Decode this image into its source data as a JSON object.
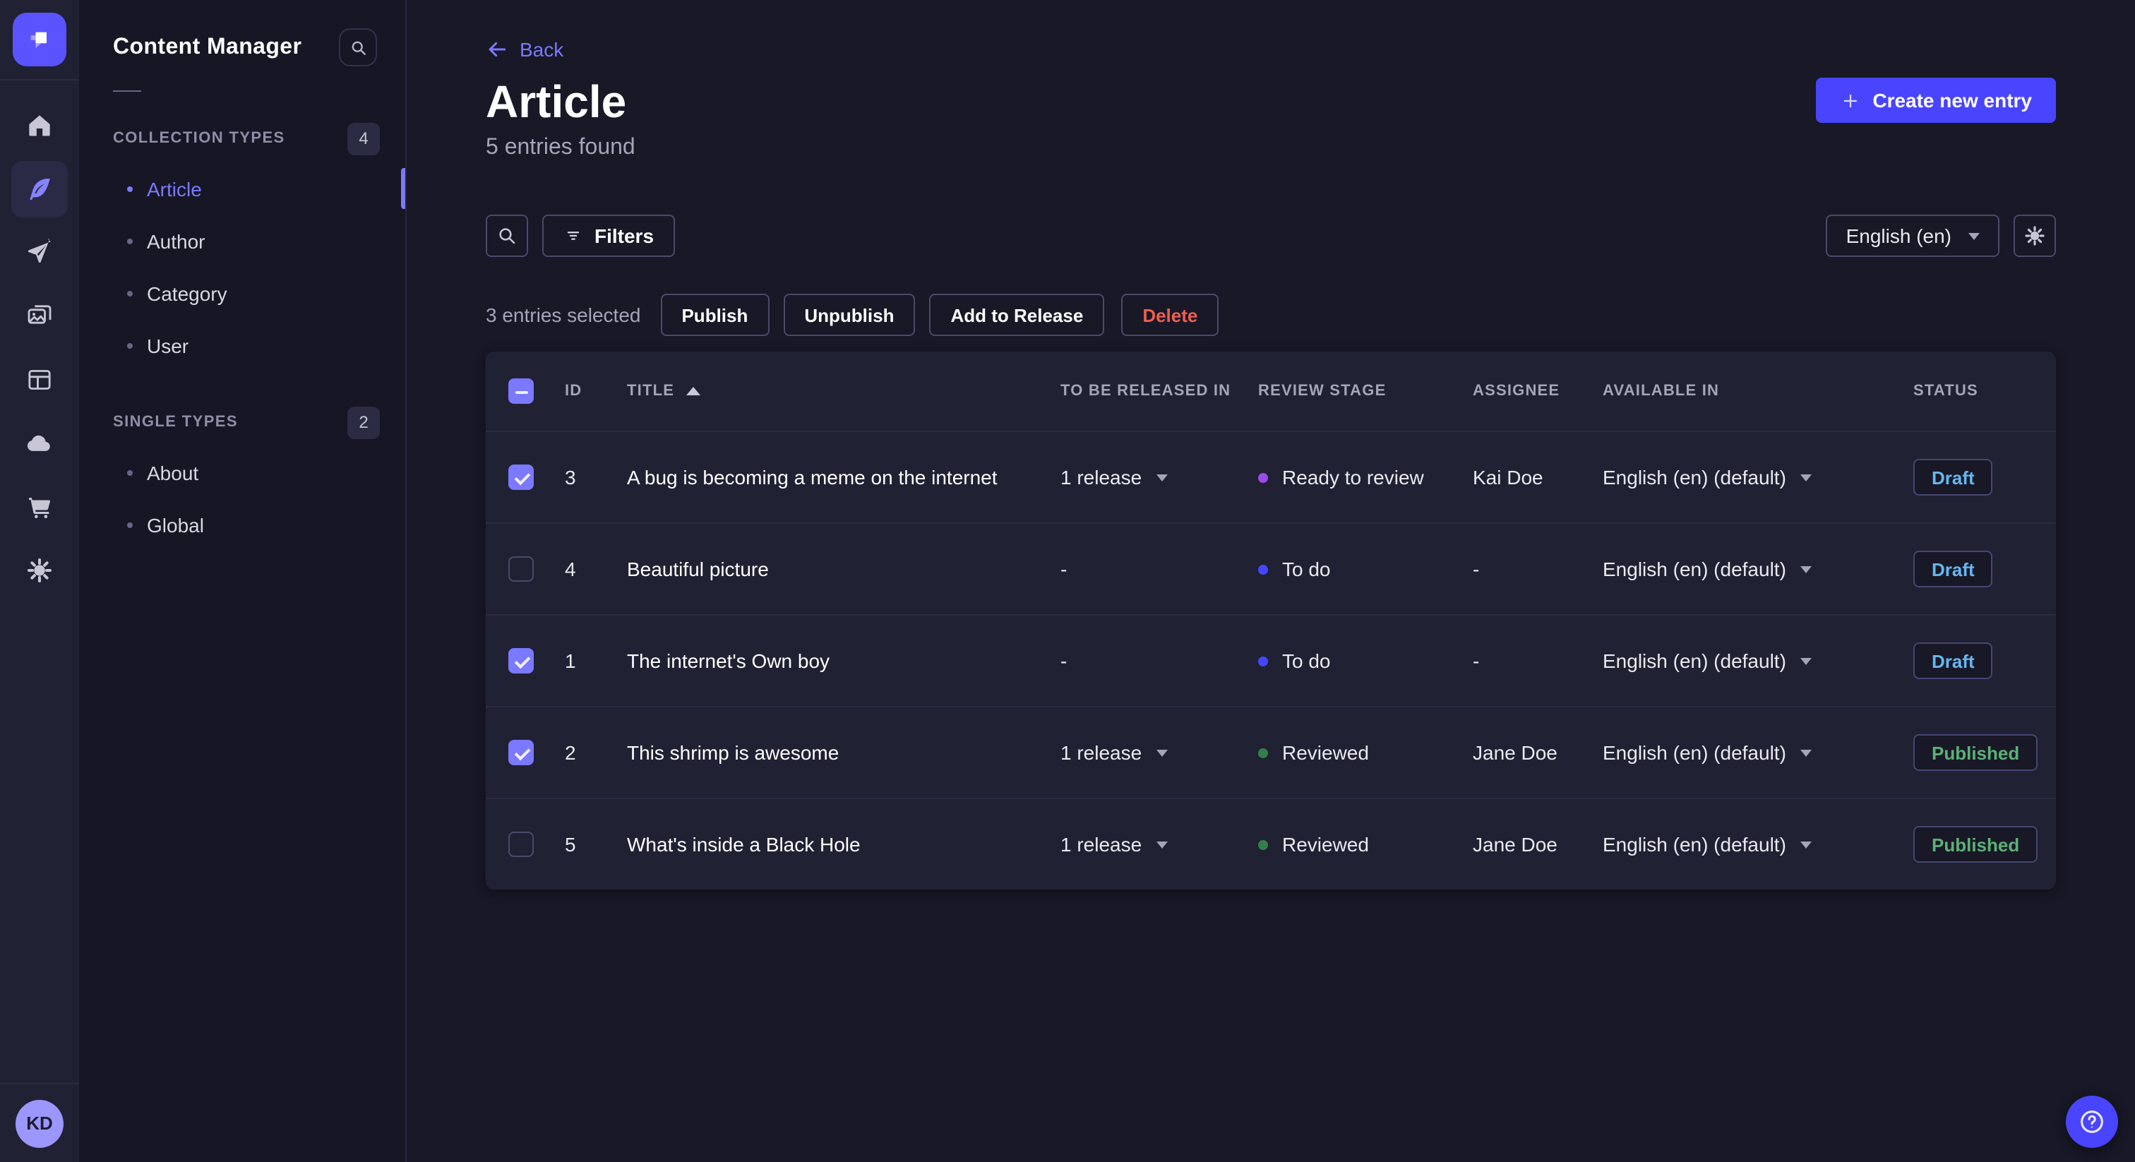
{
  "colors": {
    "primary": "#4945ff",
    "primary_light": "#7b79ff",
    "danger": "#ee5e52",
    "draft_text": "#66b7f1",
    "published_text": "#5cb176",
    "stage_ready_to_review": "#9a4be8",
    "stage_to_do": "#4347ff",
    "stage_reviewed": "#328048"
  },
  "rail": {
    "icons": [
      "home",
      "content-manager",
      "releases",
      "media-library",
      "content-type-builder",
      "cloud",
      "marketplace",
      "settings"
    ],
    "active_icon": "content-manager",
    "avatar_initials": "KD"
  },
  "subnav": {
    "title": "Content Manager",
    "sections": [
      {
        "label": "COLLECTION TYPES",
        "count": "4",
        "items": [
          {
            "label": "Article",
            "active": true
          },
          {
            "label": "Author",
            "active": false
          },
          {
            "label": "Category",
            "active": false
          },
          {
            "label": "User",
            "active": false
          }
        ]
      },
      {
        "label": "SINGLE TYPES",
        "count": "2",
        "items": [
          {
            "label": "About",
            "active": false
          },
          {
            "label": "Global",
            "active": false
          }
        ]
      }
    ]
  },
  "header": {
    "back_label": "Back",
    "title": "Article",
    "subtitle": "5 entries found",
    "create_label": "Create new entry"
  },
  "toolbar": {
    "filters_label": "Filters",
    "locale_label": "English (en)"
  },
  "selection": {
    "summary": "3 entries selected",
    "publish": "Publish",
    "unpublish": "Unpublish",
    "add_to_release": "Add to Release",
    "delete": "Delete"
  },
  "table": {
    "headers": {
      "id": "ID",
      "title": "TITLE",
      "released": "TO BE RELEASED IN",
      "stage": "REVIEW STAGE",
      "assignee": "ASSIGNEE",
      "available": "AVAILABLE IN",
      "status": "STATUS"
    },
    "rows": [
      {
        "checked": true,
        "id": "3",
        "title": "A bug is becoming a meme on the internet",
        "released": "1 release",
        "stage": "Ready to review",
        "stage_color": "#9a4be8",
        "assignee": "Kai Doe",
        "available": "English (en) (default)",
        "status": "Draft",
        "status_color": "#66b7f1"
      },
      {
        "checked": false,
        "id": "4",
        "title": "Beautiful picture",
        "released": "-",
        "stage": "To do",
        "stage_color": "#4347ff",
        "assignee": "-",
        "available": "English (en) (default)",
        "status": "Draft",
        "status_color": "#66b7f1"
      },
      {
        "checked": true,
        "id": "1",
        "title": "The internet's Own boy",
        "released": "-",
        "stage": "To do",
        "stage_color": "#4347ff",
        "assignee": "-",
        "available": "English (en) (default)",
        "status": "Draft",
        "status_color": "#66b7f1"
      },
      {
        "checked": true,
        "id": "2",
        "title": "This shrimp is awesome",
        "released": "1 release",
        "stage": "Reviewed",
        "stage_color": "#328048",
        "assignee": "Jane Doe",
        "available": "English (en) (default)",
        "status": "Published",
        "status_color": "#5cb176"
      },
      {
        "checked": false,
        "id": "5",
        "title": "What's inside a Black Hole",
        "released": "1 release",
        "stage": "Reviewed",
        "stage_color": "#328048",
        "assignee": "Jane Doe",
        "available": "English (en) (default)",
        "status": "Published",
        "status_color": "#5cb176"
      }
    ]
  }
}
